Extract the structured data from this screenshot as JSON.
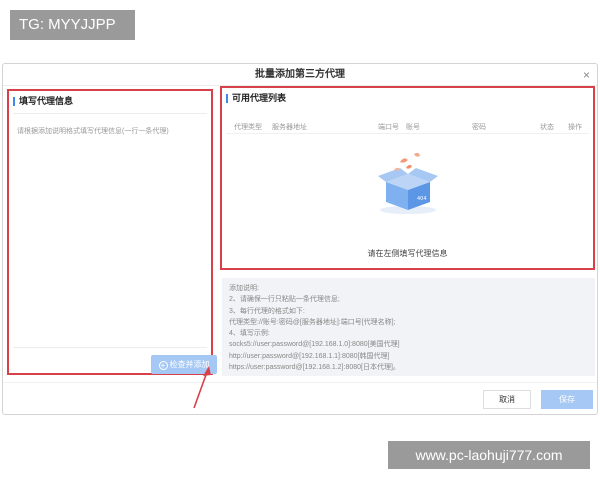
{
  "watermarks": {
    "top": "TG: MYYJJPP",
    "bottom": "www.pc-laohuji777.com"
  },
  "dialog": {
    "title": "批量添加第三方代理",
    "close_icon": "×"
  },
  "left_panel": {
    "title": "填写代理信息",
    "placeholder": "请根据添加说明格式填写代理信息(一行一条代理)",
    "add_button": "检查并添加"
  },
  "right_panel": {
    "title": "可用代理列表",
    "columns": [
      "代理类型",
      "服务器地址",
      "端口号",
      "账号",
      "密码",
      "状态",
      "操作"
    ],
    "empty_text": "请在左侧填写代理信息"
  },
  "notes": [
    "添加说明:",
    "2、请确保一行只粘贴一条代理信息;",
    "3、每行代理的格式如下:",
    "代理类型://账号:密码@[服务器地址]:端口号[代理名称];",
    "4、填写示例:",
    "socks5://user:password@[192.168.1.0]:8080[美国代理]",
    "http://user:password@[192.168.1.1]:8080[韩国代理]",
    "https://user:password@[192.168.1.2]:8080[日本代理]。"
  ],
  "footer": {
    "cancel": "取消",
    "save": "保存"
  },
  "colors": {
    "highlight": "#d8404a",
    "primary_disabled": "#a6c8f4",
    "accent": "#3b8af0"
  }
}
